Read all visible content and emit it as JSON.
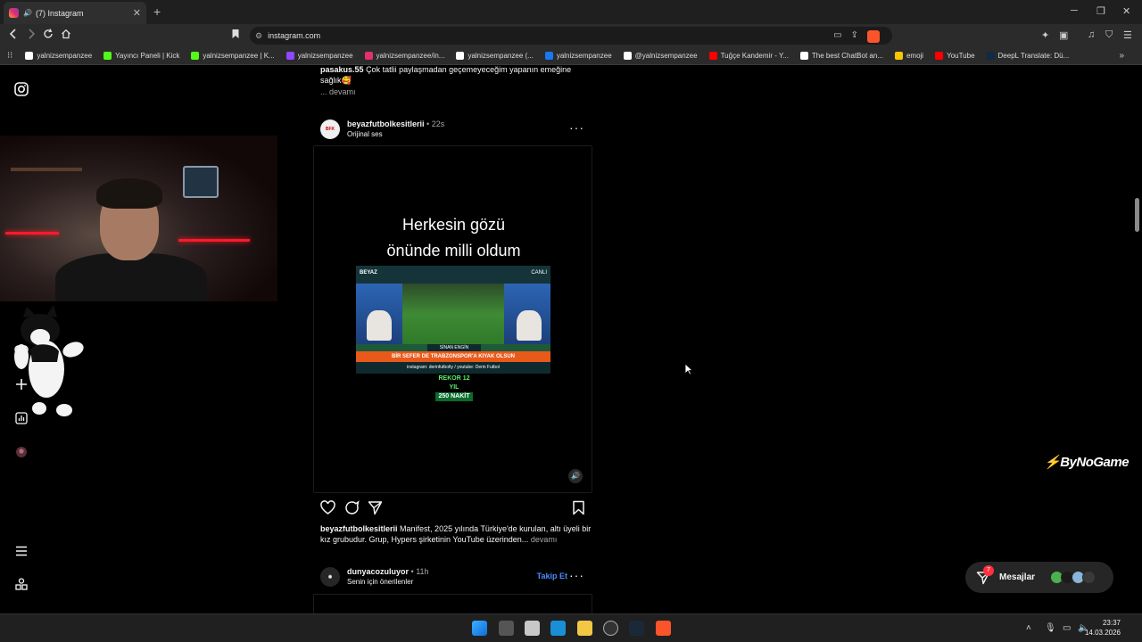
{
  "browser": {
    "tab_title": "(7) Instagram",
    "url": "instagram.com",
    "bookmarks": [
      {
        "label": "yalnizsempanzee",
        "icon": "google-icon",
        "color": "#ffffff"
      },
      {
        "label": "Yayıncı Paneli | Kick",
        "icon": "kick-icon",
        "color": "#53fc18"
      },
      {
        "label": "yalnizsempanzee | K...",
        "icon": "kick-icon",
        "color": "#53fc18"
      },
      {
        "label": "yalnizsempanzee",
        "icon": "twitch-icon",
        "color": "#9146ff"
      },
      {
        "label": "yalnizsempanzee/in...",
        "icon": "instagram-icon",
        "color": "#e1306c"
      },
      {
        "label": "yalnizsempanzee (...",
        "icon": "tiktok-icon",
        "color": "#ffffff"
      },
      {
        "label": "yalnizsempanzee",
        "icon": "facebook-icon",
        "color": "#1877f2"
      },
      {
        "label": "@yalnizsempanzee",
        "icon": "x-icon",
        "color": "#ffffff"
      },
      {
        "label": "Tuğçe Kandemir - Y...",
        "icon": "youtube-icon",
        "color": "#ff0000"
      },
      {
        "label": "The best ChatBot an...",
        "icon": "chatbot-icon",
        "color": "#ffffff"
      },
      {
        "label": "emoji",
        "icon": "emoji-icon",
        "color": "#f7c600"
      },
      {
        "label": "YouTube",
        "icon": "youtube-icon",
        "color": "#ff0000"
      },
      {
        "label": "DeepL Translate: Dü...",
        "icon": "deepl-icon",
        "color": "#0f2b46"
      }
    ]
  },
  "feed": {
    "prev_caption": {
      "user": "pasakus.55",
      "text": "Çok tatlii paylaşmadan geçemeyeceğim yapanın emeğine sağlık🥰",
      "more": "... devamı"
    },
    "post": {
      "username": "beyazfutbolkesitlerii",
      "time": "22s",
      "audio": "Orijinal ses",
      "video_title_line1": "Herkesin gözü",
      "video_title_line2": "önünde milli oldum",
      "tv_channel": "BEYAZ",
      "tv_live": "CANLI",
      "tv_banner": "BİR SEFER DE TRABZONSPOR'A KIYAK OLSUN",
      "tv_name": "SİNAN ENGİN",
      "tv_sub": "instagram: derinfutbolty / youtube: Derin Futbol",
      "sponsor_top": "REKOR 12 YIL",
      "sponsor_bottom": "250 NAKİT",
      "caption_user": "beyazfutbolkesitlerii",
      "caption_text": "Manifest, 2025 yılında Türkiye'de kurulan, altı üyeli bir kız grubudur. Grup, Hypers şirketinin YouTube üzerinden...",
      "caption_more": "devamı"
    },
    "suggested": {
      "username": "dunyacozuluyor",
      "time": "11h",
      "subtitle": "Senin için önerilenler",
      "follow": "Takip Et"
    }
  },
  "overlay": {
    "watermark": "ByNoGame"
  },
  "messages": {
    "label": "Mesajlar",
    "badge": "7"
  },
  "taskbar": {
    "time": "23:37",
    "date": "14.03.2026"
  },
  "colors": {
    "accent_blue": "#4a8df8",
    "badge_red": "#ff3040",
    "brave_orange": "#fb542b"
  }
}
